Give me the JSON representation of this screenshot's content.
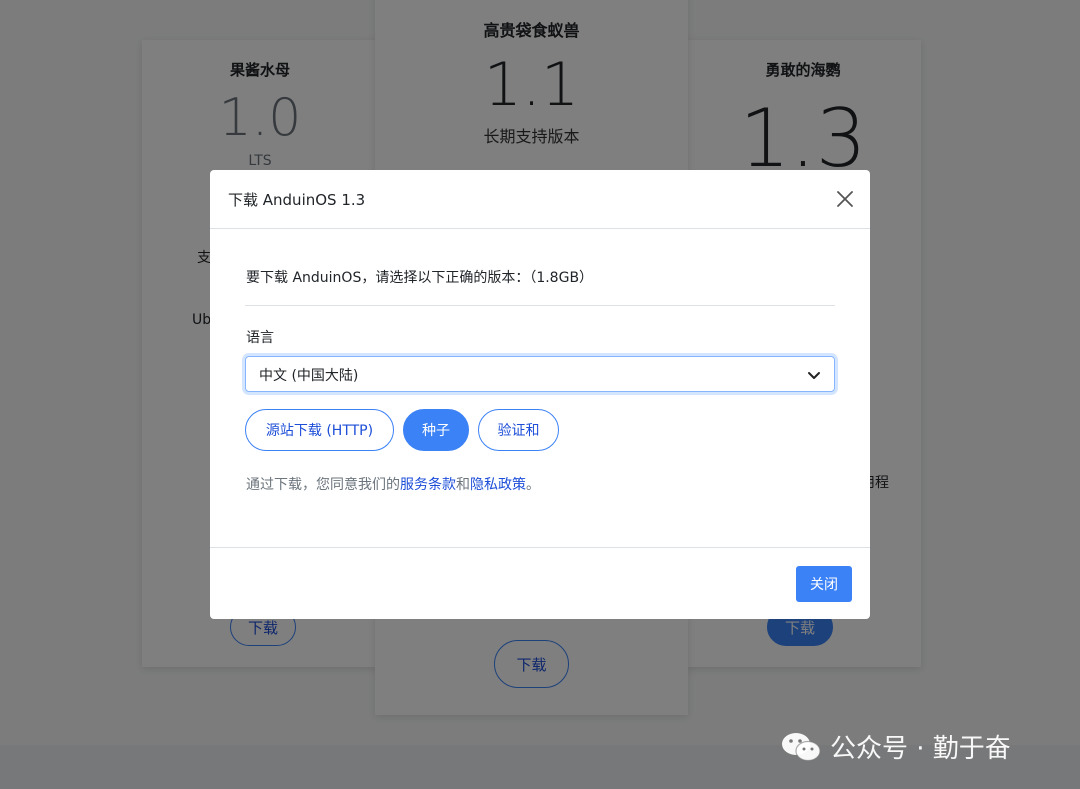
{
  "cards": [
    {
      "name": "果酱水母",
      "version": "1.0",
      "subtitle": "LTS",
      "partial_lines": [
        "支",
        "Ub"
      ],
      "button": "下载"
    },
    {
      "name": "高贵袋食蚁兽",
      "version": "1.1",
      "subtitle": "长期支持版本",
      "button": "下载"
    },
    {
      "name": "勇敢的海鹦",
      "version": "1.3",
      "partial_lines": [
        "用程"
      ],
      "button": "下载"
    }
  ],
  "modal": {
    "title": "下载 AnduinOS 1.3",
    "intro": "要下载 AnduinOS，请选择以下正确的版本：（1.8GB）",
    "language_label": "语言",
    "language_selected": "中文 (中国大陆)",
    "buttons": {
      "http": "源站下载 (HTTP)",
      "torrent": "种子",
      "checksum": "验证和"
    },
    "terms_prefix": "通过下载，您同意我们的",
    "terms_link": "服务条款",
    "terms_and": "和",
    "privacy_link": "隐私政策",
    "terms_suffix": "。",
    "close_label": "关闭"
  },
  "watermark": {
    "text": "公众号 · 勤于奋",
    "icon": "wechat-icon"
  },
  "colors": {
    "accent": "#3b82f6",
    "overlay": "rgba(0,0,0,0.5)"
  }
}
